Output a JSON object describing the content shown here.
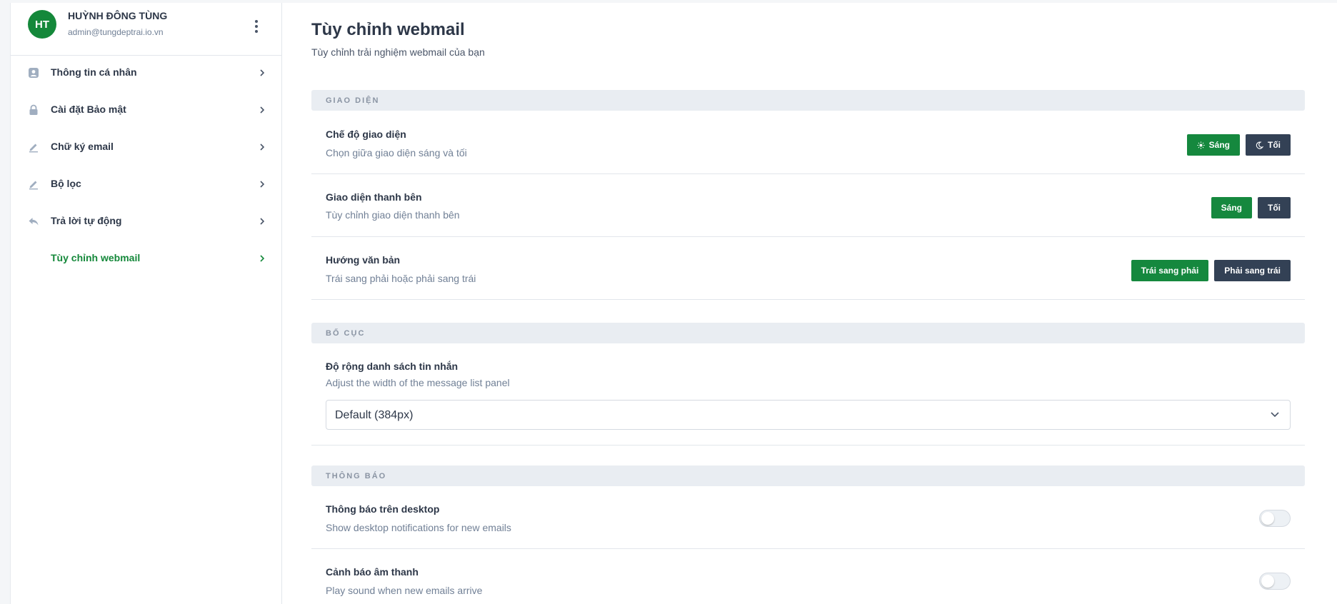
{
  "user": {
    "initials": "HT",
    "name": "HUỲNH ĐÔNG TÙNG",
    "email": "admin@tungdeptrai.io.vn"
  },
  "menu": [
    {
      "label": "Thông tin cá nhân",
      "icon": "user-card-icon",
      "active": false
    },
    {
      "label": "Cài đặt Bảo mật",
      "icon": "lock-icon",
      "active": false
    },
    {
      "label": "Chữ ký email",
      "icon": "pen-icon",
      "active": false
    },
    {
      "label": "Bộ lọc",
      "icon": "pen-icon",
      "active": false
    },
    {
      "label": "Trả lời tự động",
      "icon": "reply-icon",
      "active": false
    },
    {
      "label": "Tùy chỉnh webmail",
      "icon": "",
      "active": true
    }
  ],
  "page": {
    "title": "Tùy chỉnh webmail",
    "subtitle": "Tùy chỉnh trải nghiệm webmail của bạn"
  },
  "sections": {
    "appearance": {
      "heading": "GIAO DIỆN",
      "theme_mode": {
        "title": "Chế độ giao diện",
        "desc": "Chọn giữa giao diện sáng và tối",
        "light_label": "Sáng",
        "dark_label": "Tối"
      },
      "sidebar_theme": {
        "title": "Giao diện thanh bên",
        "desc": "Tùy chỉnh giao diện thanh bên",
        "light_label": "Sáng",
        "dark_label": "Tối"
      },
      "text_direction": {
        "title": "Hướng văn bản",
        "desc": "Trái sang phải hoặc phải sang trái",
        "ltr_label": "Trái sang phải",
        "rtl_label": "Phải sang trái"
      }
    },
    "layout": {
      "heading": "BỐ CỤC",
      "message_list_width": {
        "title": "Độ rộng danh sách tin nhắn",
        "desc": "Adjust the width of the message list panel",
        "selected": "Default (384px)"
      }
    },
    "notifications": {
      "heading": "THÔNG BÁO",
      "desktop": {
        "title": "Thông báo trên desktop",
        "desc": "Show desktop notifications for new emails",
        "enabled": false
      },
      "sound": {
        "title": "Cảnh báo âm thanh",
        "desc": "Play sound when new emails arrive",
        "enabled": false
      }
    }
  },
  "colors": {
    "accent": "#15883e",
    "dark_button": "#334155",
    "section_bg": "#e9edf2"
  }
}
